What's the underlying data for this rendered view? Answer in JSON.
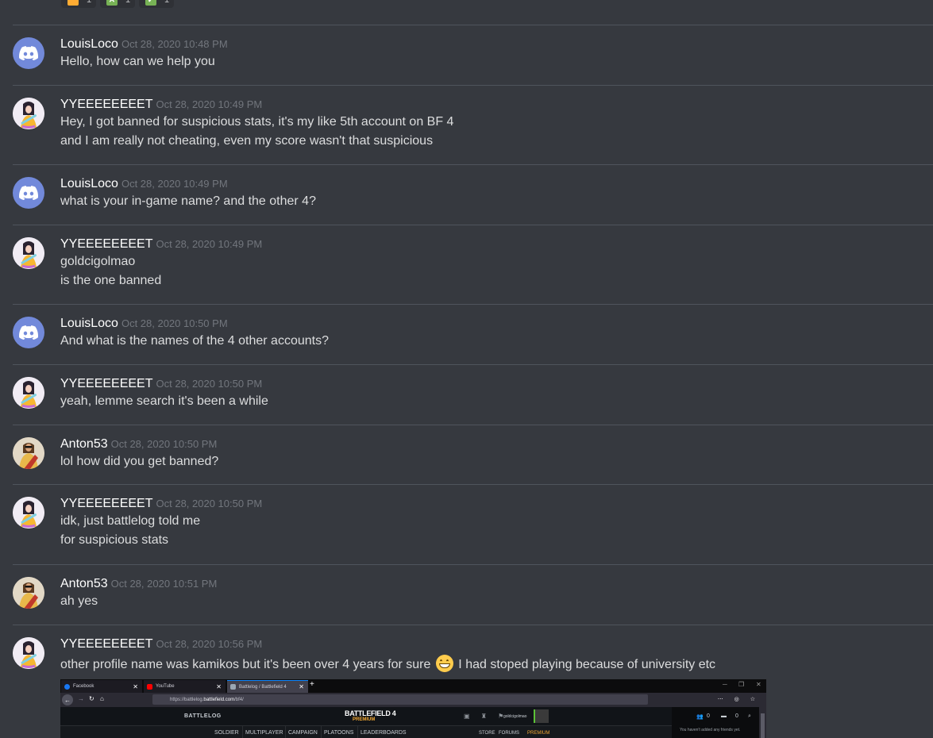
{
  "reactions": [
    {
      "emoji": "orange-square",
      "color": "#ffac33",
      "count": "1"
    },
    {
      "emoji": "x-mark",
      "color": "#77b255",
      "count": "1"
    },
    {
      "emoji": "check-mark",
      "color": "#77b255",
      "count": "1"
    }
  ],
  "messages": [
    {
      "author": "LouisLoco",
      "avatar": "discord-default",
      "timestamp": "Oct 28, 2020 10:48 PM",
      "lines": [
        "Hello, how can we help you"
      ]
    },
    {
      "author": "YYEEEEEEEET",
      "avatar": "girl",
      "timestamp": "Oct 28, 2020 10:49 PM",
      "lines": [
        "Hey, I got banned for suspicious stats, it's my like 5th account on BF 4",
        "and I am really not cheating, even my score wasn't that suspicious"
      ]
    },
    {
      "author": "LouisLoco",
      "avatar": "discord-default",
      "timestamp": "Oct 28, 2020 10:49 PM",
      "lines": [
        "what is your in-game name? and the other 4?"
      ]
    },
    {
      "author": "YYEEEEEEEET",
      "avatar": "girl",
      "timestamp": "Oct 28, 2020 10:49 PM",
      "lines": [
        "goldcigolmao",
        "is the one banned"
      ]
    },
    {
      "author": "LouisLoco",
      "avatar": "discord-default",
      "timestamp": "Oct 28, 2020 10:50 PM",
      "lines": [
        "And what is the names of the 4 other accounts?"
      ]
    },
    {
      "author": "YYEEEEEEEET",
      "avatar": "girl",
      "timestamp": "Oct 28, 2020 10:50 PM",
      "lines": [
        "yeah, lemme search it's been a while"
      ]
    },
    {
      "author": "Anton53",
      "avatar": "jesus",
      "timestamp": "Oct 28, 2020 10:50 PM",
      "lines": [
        "lol how did you get banned?"
      ]
    },
    {
      "author": "YYEEEEEEEET",
      "avatar": "girl",
      "timestamp": "Oct 28, 2020 10:50 PM",
      "lines": [
        "idk, just battlelog told me",
        "for suspicious stats"
      ]
    },
    {
      "author": "Anton53",
      "avatar": "jesus",
      "timestamp": "Oct 28, 2020 10:51 PM",
      "lines": [
        "ah yes"
      ]
    },
    {
      "author": "YYEEEEEEEET",
      "avatar": "girl",
      "timestamp": "Oct 28, 2020 10:56 PM",
      "text_before_emoji": "other profile name was kamikos but it's been over 4 years for sure",
      "emoji": "grinning-face",
      "text_after_emoji": "I had stoped playing because of university etc"
    }
  ],
  "attachment": {
    "tabs": [
      {
        "label": "Facebook",
        "icon_color": "#1877f2"
      },
      {
        "label": "YouTube",
        "icon_color": "#ff0000"
      },
      {
        "label": "Battlelog / Battlefield 4",
        "icon_color": "#9aa7b4",
        "active": true
      }
    ],
    "new_tab": "+",
    "url_prefix": "https://battlelog.",
    "url_domain": "battlefield.com",
    "url_path": "/bf4/",
    "site": {
      "logo": "BATTLELOG",
      "game_title": "BATTLEFIELD 4",
      "game_edition": "PREMIUM",
      "username": "goldcigolmao",
      "nav": [
        "SOLDIER",
        "MULTIPLAYER",
        "CAMPAIGN",
        "PLATOONS",
        "LEADERBOARDS"
      ],
      "links": [
        "STORE",
        "FORUMS",
        "PREMIUM"
      ],
      "friends_count": "0",
      "messages_count": "0",
      "friends_empty": "You haven't added any friends yet."
    }
  }
}
